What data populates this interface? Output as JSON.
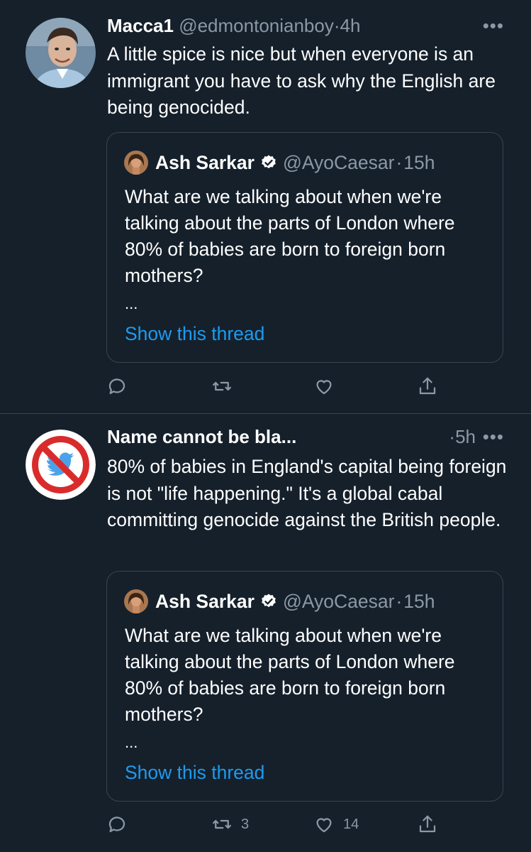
{
  "tweets": [
    {
      "author": {
        "name": "Macca1",
        "handle": "@edmontonianboy",
        "avatar": "person-photo-avatar"
      },
      "time": "4h",
      "text": "A little spice is nice but when everyone is an immigrant you have to ask why the English are being genocided.",
      "quoted": {
        "author": {
          "name": "Ash Sarkar",
          "handle": "@AyoCaesar",
          "verified": true
        },
        "time": "15h",
        "text": "What are we talking about when we're talking about the parts of London where 80% of babies are born to foreign born mothers?",
        "ellipsis": "...",
        "link": "Show this thread"
      },
      "actions": {
        "replies": "",
        "retweets": "",
        "likes": ""
      }
    },
    {
      "author": {
        "name": "Name cannot be bla...",
        "handle": "",
        "avatar": "no-twitter-bird-avatar"
      },
      "time": "5h",
      "text": "80% of babies in England's capital being foreign is not \"life happening.\" It's a global cabal committing genocide against the British people.",
      "quoted": {
        "author": {
          "name": "Ash Sarkar",
          "handle": "@AyoCaesar",
          "verified": true
        },
        "time": "15h",
        "text": "What are we talking about when we're talking about the parts of London where 80% of babies are born to foreign born mothers?",
        "ellipsis": "...",
        "link": "Show this thread"
      },
      "actions": {
        "replies": "",
        "retweets": "3",
        "likes": "14"
      }
    }
  ],
  "ui": {
    "dot": "·",
    "more": "•••"
  },
  "colors": {
    "background": "#15202b",
    "border": "#38444d",
    "muted": "#8b98a5",
    "link": "#1d9bf0",
    "verified": "#ffffff"
  }
}
